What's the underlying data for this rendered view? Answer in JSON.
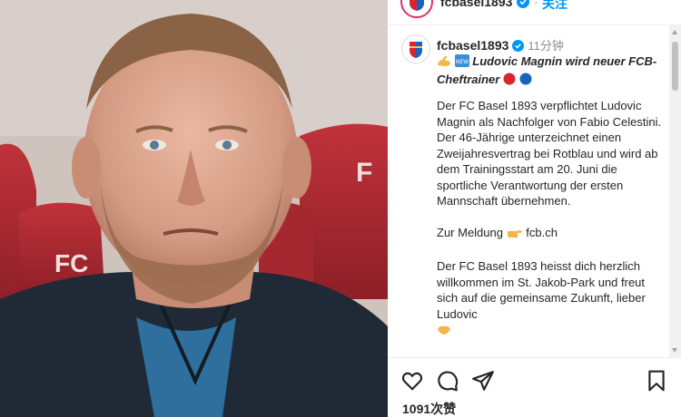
{
  "header": {
    "username": "fcbasel1893",
    "follow_label": "关注"
  },
  "post": {
    "username": "fcbasel1893",
    "time": "11分钟",
    "title": "Ludovic Magnin wird neuer FCB-Cheftrainer",
    "paragraphs": [
      "Der FC Basel 1893 verpflichtet Ludovic Magnin als Nachfolger von Fabio Celestini. Der 46-Jährige unterzeichnet einen Zweijahresvertrag bei Rotblau und wird ab dem Trainingsstart am 20. Juni die sportliche Verantwortung der ersten Mannschaft übernehmen.",
      "Der FC Basel 1893 heisst dich herzlich willkommen im St. Jakob-Park und freut sich auf die gemeinsame Zukunft, lieber Ludovic"
    ],
    "meldung_label": "Zur Meldung",
    "meldung_link": "fcb.ch",
    "likes": "1091次赞"
  },
  "colors": {
    "brand_red": "#d7262f",
    "brand_blue": "#1565c0",
    "link_blue": "#0095f6",
    "verified_blue": "#0095f6"
  },
  "icons": [
    "heart-icon",
    "comment-icon",
    "share-icon",
    "bookmark-icon",
    "verified-icon",
    "flex-arm-icon",
    "new-icon",
    "pointing-right-icon",
    "red-circle-icon",
    "blue-circle-icon"
  ]
}
